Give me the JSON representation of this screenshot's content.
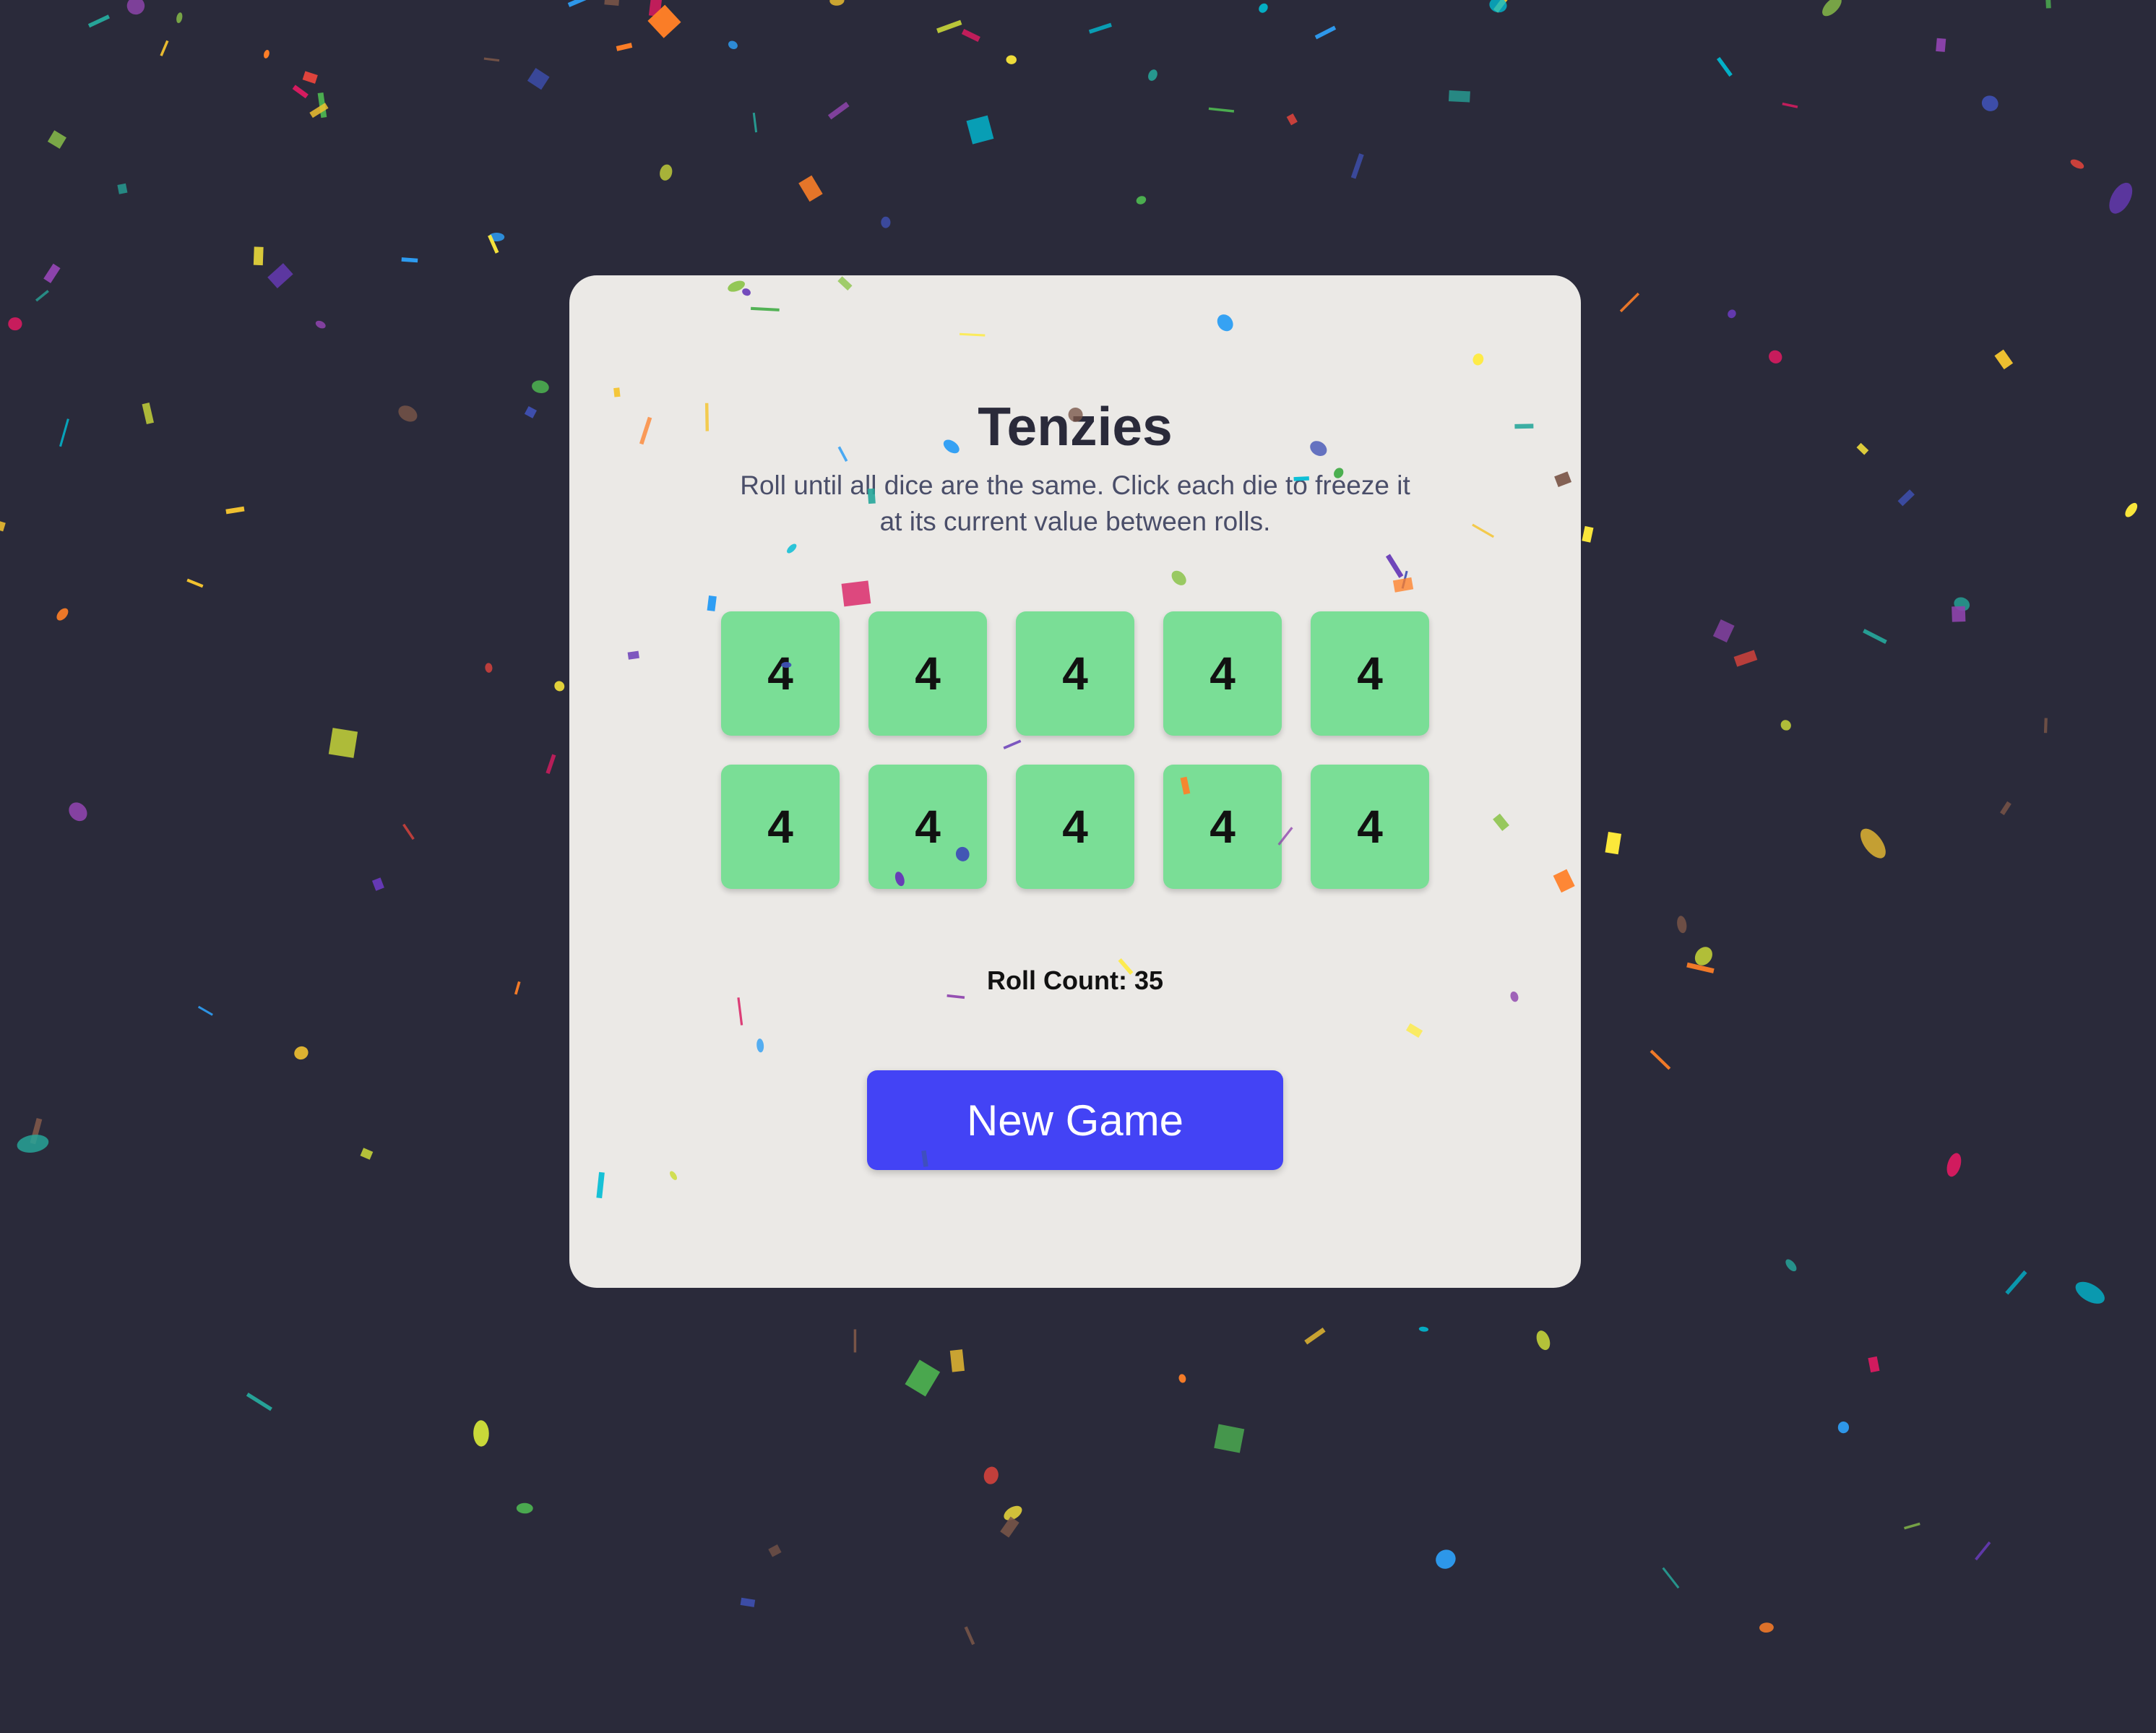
{
  "game": {
    "title": "Tenzies",
    "instructions": "Roll until all dice are the same. Click each die to freeze it at its current value between rolls.",
    "dice": [
      {
        "value": "4",
        "held": true
      },
      {
        "value": "4",
        "held": true
      },
      {
        "value": "4",
        "held": true
      },
      {
        "value": "4",
        "held": true
      },
      {
        "value": "4",
        "held": true
      },
      {
        "value": "4",
        "held": true
      },
      {
        "value": "4",
        "held": true
      },
      {
        "value": "4",
        "held": true
      },
      {
        "value": "4",
        "held": true
      },
      {
        "value": "4",
        "held": true
      }
    ],
    "roll_count_text": "Roll Count: 35",
    "new_game_label": "New Game"
  },
  "colors": {
    "background": "#2a2a3a",
    "card": "#ebe9e6",
    "held_die": "#7ade96",
    "button": "#4343f5",
    "confetti": [
      "#f4c430",
      "#e8453c",
      "#2e9ef4",
      "#8e44ad",
      "#4caf50",
      "#ff7f27",
      "#d81b60",
      "#26a69a",
      "#cddc39",
      "#3f51b5",
      "#795548",
      "#673ab7",
      "#00bcd4",
      "#ffeb3b",
      "#8bc34a"
    ]
  }
}
